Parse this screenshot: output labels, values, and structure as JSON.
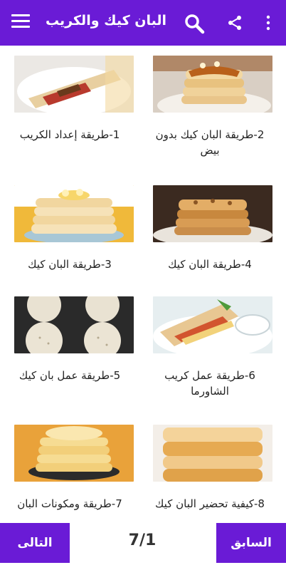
{
  "header": {
    "title": "البان كيك والكريب",
    "icons": [
      "menu-icon",
      "search-icon",
      "share-icon",
      "more-vert-icon"
    ]
  },
  "recipes": [
    {
      "label": "2-طريقة البان كيك بدون بيض"
    },
    {
      "label": "1-طريقة إعداد الكريب"
    },
    {
      "label": "4-طريقة البان كيك"
    },
    {
      "label": "3-طريقة البان كيك"
    },
    {
      "label": "6-طريقة عمل كريب الشاورما"
    },
    {
      "label": "5-طريقة عمل بان كيك"
    },
    {
      "label": "8-كيفية تحضير البان كيك"
    },
    {
      "label": "7-طريقة ومكونات البان"
    }
  ],
  "footer": {
    "next_label": "التالى",
    "prev_label": "السابق",
    "page_indicator": "7/1"
  },
  "colors": {
    "primary": "#6a1bd6",
    "text": "#222222"
  }
}
